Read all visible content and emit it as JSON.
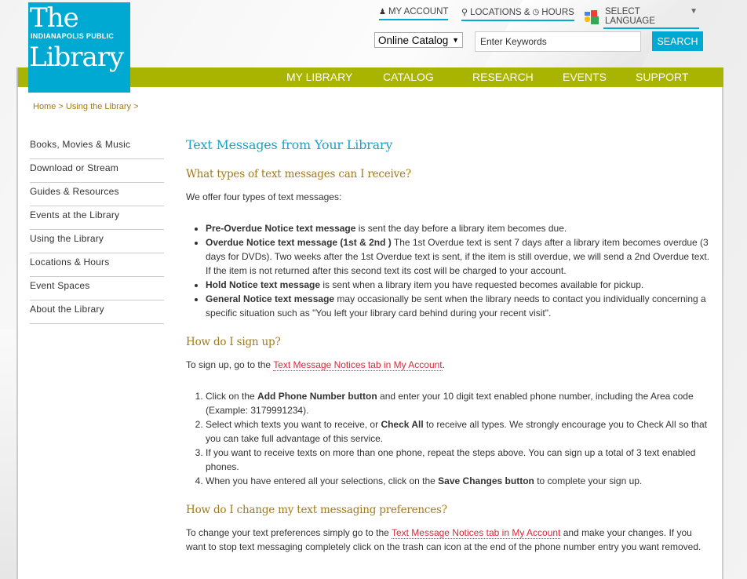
{
  "header": {
    "logo": {
      "line1": "The",
      "line2": "INDIANAPOLIS PUBLIC",
      "line3": "Library"
    },
    "top_links": {
      "my_account": "MY ACCOUNT",
      "locations": "LOCATIONS &",
      "hours": "HOURS",
      "select_language": "SELECT LANGUAGE",
      "language_arrow": "▼"
    },
    "search": {
      "catalog_select": "Online Catalog",
      "catalog_arrow": "▼",
      "placeholder": "Enter Keywords",
      "button_label": "SEARCH"
    },
    "colors": {
      "brand_blue": "#00a9d1",
      "nav_green": "#a8b400",
      "heading_gold": "#a07a17",
      "link_red": "#d8293a"
    }
  },
  "nav": {
    "items": [
      "MY LIBRARY",
      "CATALOG",
      "RESEARCH",
      "EVENTS",
      "SUPPORT"
    ]
  },
  "breadcrumb": {
    "home": "Home",
    "sep1": " > ",
    "section": "Using the Library",
    "sep2": " >"
  },
  "sidebar": {
    "items": [
      "Books, Movies & Music",
      "Download or Stream",
      "Guides & Resources",
      "Events at the Library",
      "Using the Library",
      "Locations & Hours",
      "Event Spaces",
      "About the Library"
    ]
  },
  "main": {
    "title": "Text Messages from Your Library",
    "section1": {
      "heading": "What types of text messages can I receive?",
      "intro": "We offer four types of text messages:",
      "items": [
        {
          "bold": "Pre-Overdue Notice text message",
          "text": " is sent the day before a library item becomes due."
        },
        {
          "bold": "Overdue Notice text message (1st & 2nd )",
          "text": " The 1st Overdue text is sent 7 days after a library item becomes overdue (3 days for DVDs). Two weeks after the 1st Overdue text is sent, if the item is still overdue, we will send a 2nd Overdue text. If the item is not returned after this second text its cost will be charged to your account."
        },
        {
          "bold": "Hold Notice text message",
          "text": " is sent when a library item you have requested becomes available for pickup."
        },
        {
          "bold": "General Notice text message",
          "text": " may occasionally be sent when the library needs to contact you individually concerning a specific situation such as \"You left your library card behind during your recent visit\"."
        }
      ]
    },
    "section2": {
      "heading": "How do I sign up?",
      "intro_pre": "To sign up, go to the ",
      "intro_link": "Text Message Notices tab in My Account",
      "intro_post": ".",
      "steps": [
        {
          "pre": "Click on the ",
          "bold": "Add Phone Number button",
          "post": " and enter your 10 digit text enabled phone number, including the Area code (Example: 3179991234)."
        },
        {
          "pre": "Select which texts you want to receive, or ",
          "bold": "Check All",
          "post": " to receive all types. We strongly encourage you to Check All so that you can take full advantage of this service."
        },
        {
          "pre": "If you want to receive texts on more than one phone, repeat the steps above. You can sign up a total of 3 text enabled phones.",
          "bold": "",
          "post": ""
        },
        {
          "pre": "When you have entered all your selections, click on the ",
          "bold": "Save Changes button",
          "post": " to complete your sign up."
        }
      ]
    },
    "section3": {
      "heading": "How do I change my text messaging preferences?",
      "text_pre": "To change your text preferences simply go to the ",
      "text_link": "Text Message Notices tab in My Account",
      "text_post": " and make your changes. If you want to stop text messaging completely click on the trash can icon at the end of the phone number entry you want removed."
    }
  }
}
